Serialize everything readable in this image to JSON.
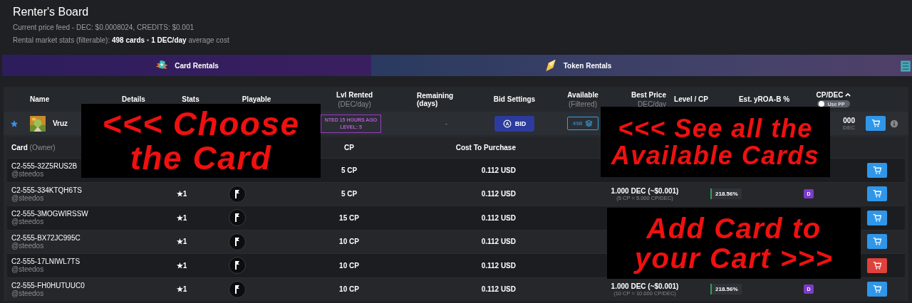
{
  "header": {
    "title": "Renter's Board",
    "price_feed": "Current price feed - DEC: $0.0008024, CREDITS: $0.001",
    "stats": "Rental market stats (filterable): **498 cards** • **1 DEC/day** average cost"
  },
  "tabs": [
    {
      "label": "Card Rentals",
      "selected": true
    },
    {
      "label": "Token Rentals",
      "selected": false
    }
  ],
  "columns": [
    {
      "label": "Name"
    },
    {
      "label": "Details"
    },
    {
      "label": "Stats"
    },
    {
      "label": "Playable"
    },
    {
      "label": "Lvl Rented",
      "sub": "(DEC/day)"
    },
    {
      "label": "Remaining (days)"
    },
    {
      "label": "Bid Settings"
    },
    {
      "label": "Available",
      "sub": "(Filtered)"
    },
    {
      "label": "Best Price",
      "sub": "DEC/day"
    },
    {
      "label": "Level / CP"
    },
    {
      "label": "Est. yROA-B %"
    },
    {
      "label": "CP/DEC",
      "sorted": true,
      "toggle": {
        "label": "Use PP",
        "on": false
      }
    }
  ],
  "card_row": {
    "favorite": true,
    "name": "Vruz",
    "rented": "NTED 15 HOURS AGO",
    "level": "LEVEL: 5",
    "remaining": "-",
    "bid": "BID",
    "available": "498",
    "cp_dec": "000",
    "cp_dec_unit": "DEC"
  },
  "listings": {
    "card_label": "Card",
    "owner_label": "(Owner)",
    "cp_label": "CP",
    "cost_label": "Cost To Purchase",
    "rows": [
      {
        "card": "C2-555-32Z5RUS2B",
        "owner": "@steedos",
        "cp": "5 CP",
        "cost": "0.112 USD",
        "in_cart": false
      },
      {
        "card": "C2-555-334KTQH6TS",
        "owner": "@steedos",
        "rating": "★1",
        "cp": "5 CP",
        "cost": "0.112 USD",
        "price": "1.000 DEC (~$0.001)",
        "price_note": "(5 CP = 5.000 CP/DEC)",
        "yroa": "218.56%",
        "badge": "D",
        "in_cart": false
      },
      {
        "card": "C2-555-3MOGWIRSSW",
        "owner": "@steedos",
        "rating": "★1",
        "cp": "15 CP",
        "cost": "0.112 USD",
        "in_cart": false
      },
      {
        "card": "C2-555-BX72JC995C",
        "owner": "@steedos",
        "rating": "★1",
        "cp": "10 CP",
        "cost": "0.112 USD",
        "in_cart": false
      },
      {
        "card": "C2-555-17LNIWL7TS",
        "owner": "@steedos",
        "rating": "★1",
        "cp": "10 CP",
        "cost": "0.112 USD",
        "in_cart": true
      },
      {
        "card": "C2-555-FH0HUTUUC0",
        "owner": "@steedos",
        "rating": "★1",
        "cp": "10 CP",
        "cost": "0.112 USD",
        "price": "1.000 DEC (~$0.001)",
        "price_note": "(10 CP = 10.000 CP/DEC)",
        "yroa": "218.56%",
        "badge": "D",
        "in_cart": false
      }
    ]
  },
  "annotations": [
    {
      "lines": [
        "<<< Choose",
        "the Card"
      ]
    },
    {
      "lines": [
        "<<< See all the",
        "Available Cards"
      ]
    },
    {
      "lines": [
        "Add Card to",
        "your Cart >>>"
      ]
    }
  ]
}
